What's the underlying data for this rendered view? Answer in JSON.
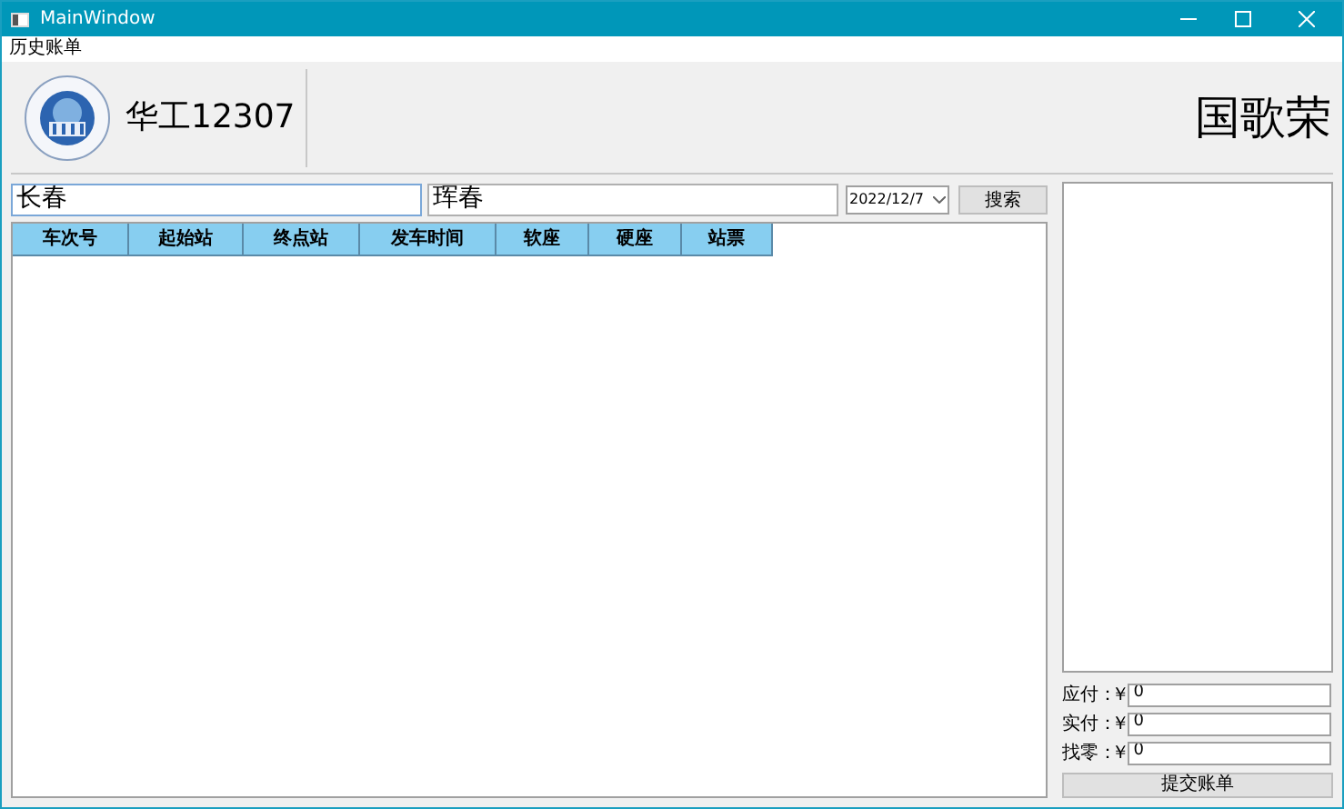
{
  "window": {
    "title": "MainWindow"
  },
  "menu": [
    "历史账单"
  ],
  "header": {
    "app_title": "华工12307",
    "user_name": "国歌荣"
  },
  "search": {
    "from_value": "长春",
    "to_value": "珲春",
    "date": "2022/12/7",
    "button": "搜索"
  },
  "table": {
    "columns": [
      "车次号",
      "起始站",
      "终点站",
      "发车时间",
      "软座",
      "硬座",
      "站票"
    ]
  },
  "payment": [
    {
      "label": "应付：",
      "currency": "￥",
      "value": "0"
    },
    {
      "label": "实付：",
      "currency": "￥",
      "value": "0"
    },
    {
      "label": "找零：",
      "currency": "￥",
      "value": "0"
    }
  ],
  "submit_button": "提交账单"
}
